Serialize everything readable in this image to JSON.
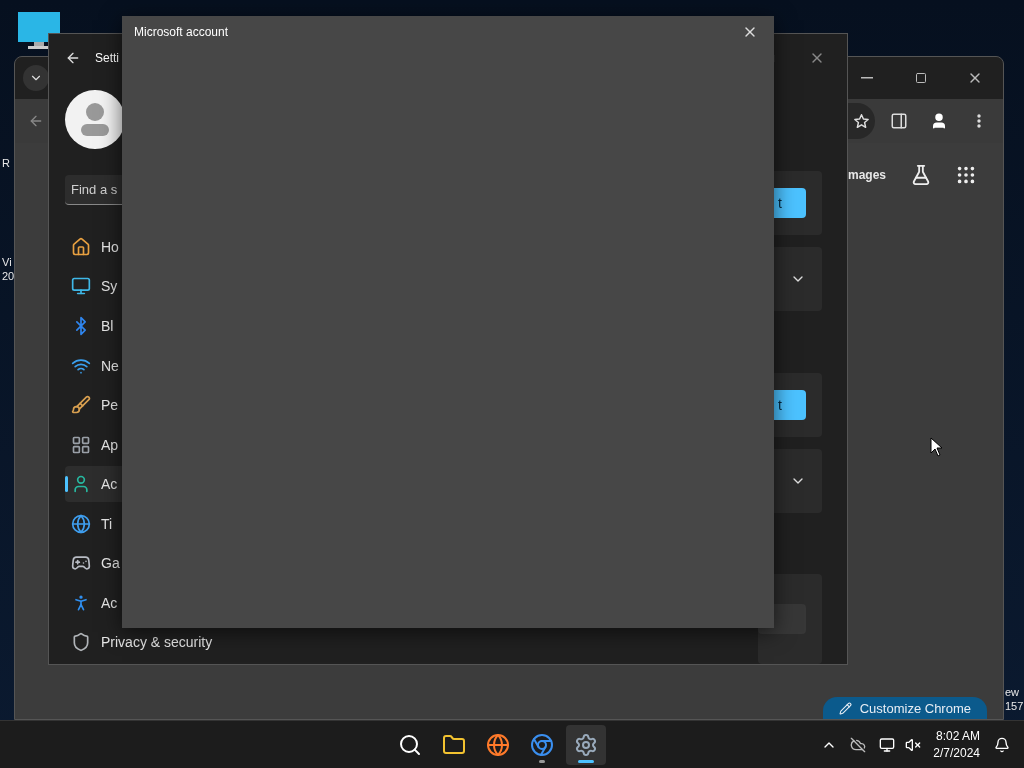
{
  "desktop": {
    "left_labels": [
      "R",
      "Vi",
      "20"
    ],
    "right_labels": [
      "ew",
      "157"
    ]
  },
  "chrome_window": {
    "images_link": "mages",
    "customize_button": "Customize Chrome"
  },
  "settings_window": {
    "title": "Setti",
    "search": {
      "placeholder": "Find a s"
    },
    "nav": [
      {
        "label": "Ho",
        "selected": false
      },
      {
        "label": "Sy",
        "selected": false
      },
      {
        "label": "Bl",
        "selected": false
      },
      {
        "label": "Ne",
        "selected": false
      },
      {
        "label": "Pe",
        "selected": false
      },
      {
        "label": "Ap",
        "selected": false
      },
      {
        "label": "Ac",
        "selected": true
      },
      {
        "label": "Ti",
        "selected": false
      },
      {
        "label": "Ga",
        "selected": false
      },
      {
        "label": "Ac",
        "selected": false
      },
      {
        "label": "Privacy & security",
        "selected": false
      }
    ],
    "cards": [
      {
        "kind": "button",
        "button": "t"
      },
      {
        "kind": "expander"
      },
      {
        "kind": "spacer"
      },
      {
        "kind": "button",
        "button": "t"
      },
      {
        "kind": "expander"
      },
      {
        "kind": "spacer"
      },
      {
        "kind": "field"
      }
    ]
  },
  "dialog": {
    "title": "Microsoft account"
  },
  "taskbar": {
    "apps": [
      {
        "selected": false,
        "running": false
      },
      {
        "selected": false,
        "running": false
      },
      {
        "selected": false,
        "running": false
      },
      {
        "selected": false,
        "running": true
      },
      {
        "selected": true,
        "running": true
      }
    ],
    "time": "8:02 AM",
    "date": "2/7/2024"
  }
}
